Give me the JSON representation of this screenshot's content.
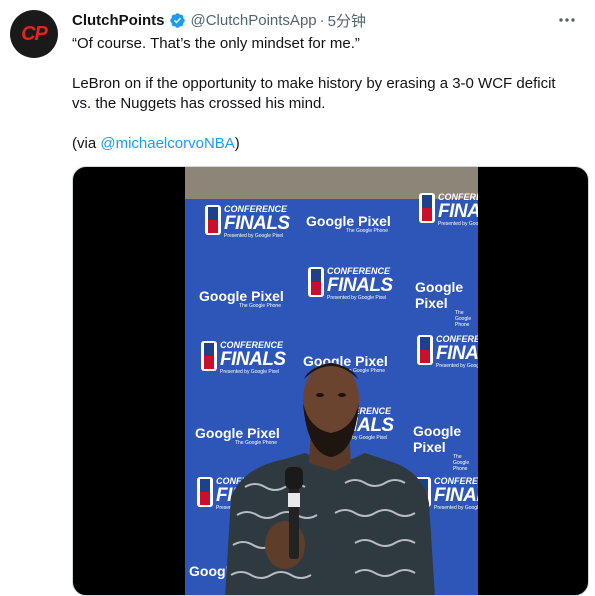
{
  "tweet": {
    "avatar_logo": "CP",
    "display_name": "ClutchPoints",
    "handle": "@ClutchPointsApp",
    "separator": "·",
    "time": "5分钟",
    "line1": "“Of course. That’s the only mindset for me.”",
    "line2a": "LeBron on if the opportunity to make history by erasing a 3-0 WCF deficit",
    "line2b": "vs. the Nuggets has crossed his mind.",
    "via_prefix": "(via ",
    "via_link": "@michaelcorvoNBA",
    "via_suffix": ")"
  },
  "backdrop": {
    "sponsor": "Google Pixel",
    "sponsor_sub": "The Google Phone",
    "conference": "CONFERENCE",
    "finals": "FINALS",
    "presented": "Presented by Google Pixel"
  },
  "icons": {
    "verified": "verified-badge-icon",
    "more": "more-options-icon"
  },
  "colors": {
    "link": "#1d9bf0",
    "verified": "#1d9bf0",
    "backdrop_blue": "#2e56b8",
    "brand_red": "#e0261b"
  }
}
